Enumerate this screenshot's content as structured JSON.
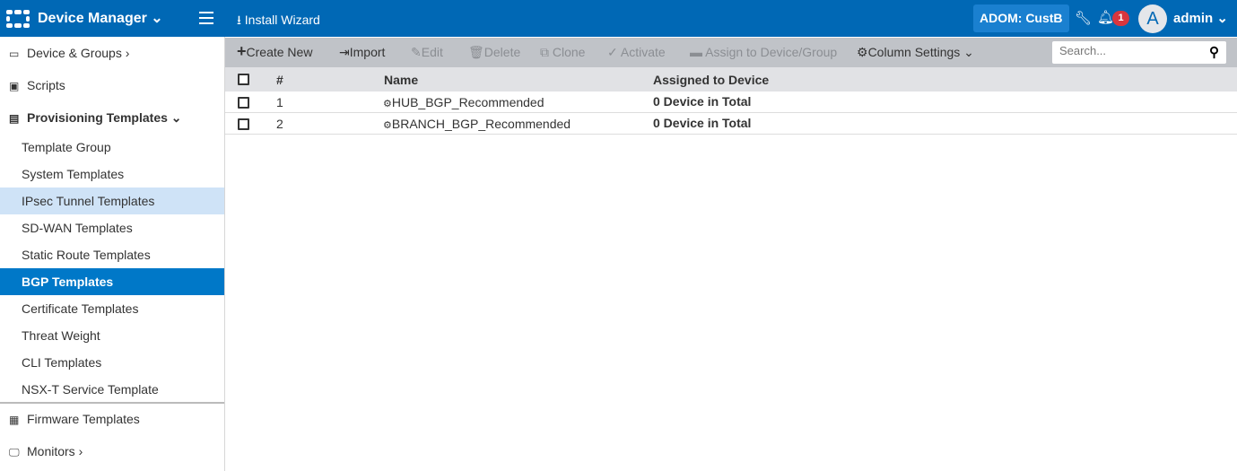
{
  "header": {
    "app_title": "Device Manager",
    "install_wizard": "Install Wizard",
    "adom": "ADOM: CustB",
    "notification_count": "1",
    "avatar_letter": "A",
    "user": "admin"
  },
  "sidebar": {
    "items": [
      {
        "label": "Device & Groups",
        "icon": "device-icon"
      },
      {
        "label": "Scripts",
        "icon": "script-icon"
      },
      {
        "label": "Provisioning Templates",
        "icon": "template-icon"
      },
      {
        "label": "Template Group"
      },
      {
        "label": "System Templates"
      },
      {
        "label": "IPsec Tunnel Templates"
      },
      {
        "label": "SD-WAN Templates"
      },
      {
        "label": "Static Route Templates"
      },
      {
        "label": "BGP Templates"
      },
      {
        "label": "Certificate Templates"
      },
      {
        "label": "Threat Weight"
      },
      {
        "label": "CLI Templates"
      },
      {
        "label": "NSX-T Service Template"
      },
      {
        "label": "Firmware Templates",
        "icon": "chip-icon"
      },
      {
        "label": "Monitors",
        "icon": "monitor-icon"
      }
    ]
  },
  "toolbar": {
    "create_new": "Create New",
    "import": "Import",
    "edit": "Edit",
    "delete": "Delete",
    "clone": "Clone",
    "activate": "Activate",
    "assign": "Assign to Device/Group",
    "column_settings": "Column Settings",
    "search_placeholder": "Search..."
  },
  "table": {
    "columns": [
      "#",
      "Name",
      "Assigned to Device"
    ],
    "rows": [
      {
        "num": "1",
        "name": "HUB_BGP_Recommended",
        "assigned": "0 Device in Total"
      },
      {
        "num": "2",
        "name": "BRANCH_BGP_Recommended",
        "assigned": "0 Device in Total"
      }
    ]
  },
  "colors": {
    "topbar": "#0068b5",
    "active": "#0078c8",
    "highlight": "#cfe3f7",
    "badge": "#d9363e"
  }
}
